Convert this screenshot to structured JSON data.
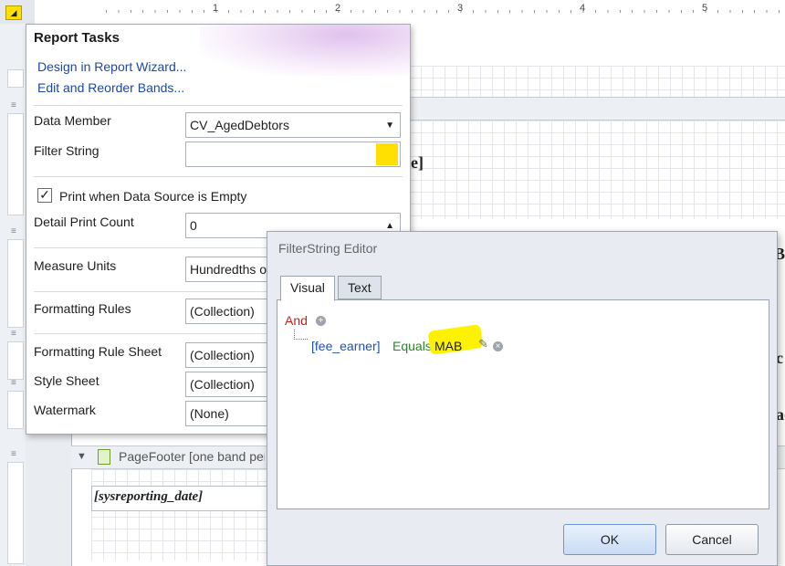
{
  "ruler": {
    "marks": [
      "1",
      "2",
      "3",
      "4",
      "5"
    ]
  },
  "report_tasks": {
    "title": "Report Tasks",
    "links": [
      "Design in Report Wizard...",
      "Edit and Reorder Bands..."
    ],
    "data_member": {
      "label": "Data Member",
      "value": "CV_AgedDebtors"
    },
    "filter_string": {
      "label": "Filter String",
      "value": ""
    },
    "print_when_empty": {
      "label": "Print when Data Source is Empty",
      "checked": true
    },
    "detail_print_count": {
      "label": "Detail Print Count",
      "value": "0"
    },
    "measure_units": {
      "label": "Measure Units",
      "value": "Hundredths of an Inch"
    },
    "formatting_rules": {
      "label": "Formatting Rules",
      "value": "(Collection)"
    },
    "formatting_rule_sheet": {
      "label": "Formatting Rule Sheet",
      "value": "(Collection)"
    },
    "style_sheet": {
      "label": "Style Sheet",
      "value": "(Collection)"
    },
    "watermark": {
      "label": "Watermark",
      "value": "(None)"
    }
  },
  "report": {
    "page_footer_band": "PageFooter [one band per page]",
    "reporting_date_field": "[sysreporting_date]"
  },
  "filter_editor": {
    "title": "FilterString Editor",
    "tabs": [
      "Visual",
      "Text"
    ],
    "group_operator": "And",
    "condition": {
      "field": "[fee_earner]",
      "operator": "Equals",
      "value": "MAB"
    },
    "ok_label": "OK",
    "cancel_label": "Cancel"
  },
  "colors": {
    "highlight": "#ffe000",
    "link": "#1c48a8",
    "and_operator": "#c8201c",
    "field": "#1d52b6",
    "operator": "#248a24"
  }
}
